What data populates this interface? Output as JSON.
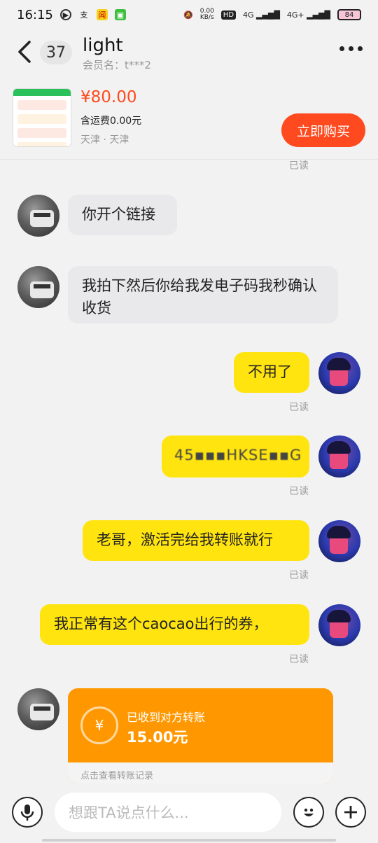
{
  "status_bar": {
    "time": "16:15",
    "net_speed": "0.00\nKB/s",
    "signal_1": "4G",
    "signal_2": "4G+",
    "hd": "HD",
    "battery": "84"
  },
  "header": {
    "unread_count": "37",
    "contact_name": "light",
    "member_label": "会员名：t***2"
  },
  "product": {
    "price": "¥80.00",
    "shipping": "含运费0.00元",
    "location": "天津 · 天津",
    "buy_label": "立即购买"
  },
  "messages": {
    "read_label": "已读",
    "m1": "你开个链接",
    "m2": "我拍下然后你给我发电子码我秒确认收货",
    "m3": "不用了",
    "m4": "45▪▪▪HKSE▪▪G",
    "m5": "老哥，激活完给我转账就行",
    "m6": "我正常有这个caocao出行的券，"
  },
  "transfer": {
    "currency_symbol": "¥",
    "label": "已收到对方转账",
    "amount": "15.00元",
    "footer": "点击查看转账记录"
  },
  "input": {
    "placeholder": "想跟TA说点什么..."
  }
}
